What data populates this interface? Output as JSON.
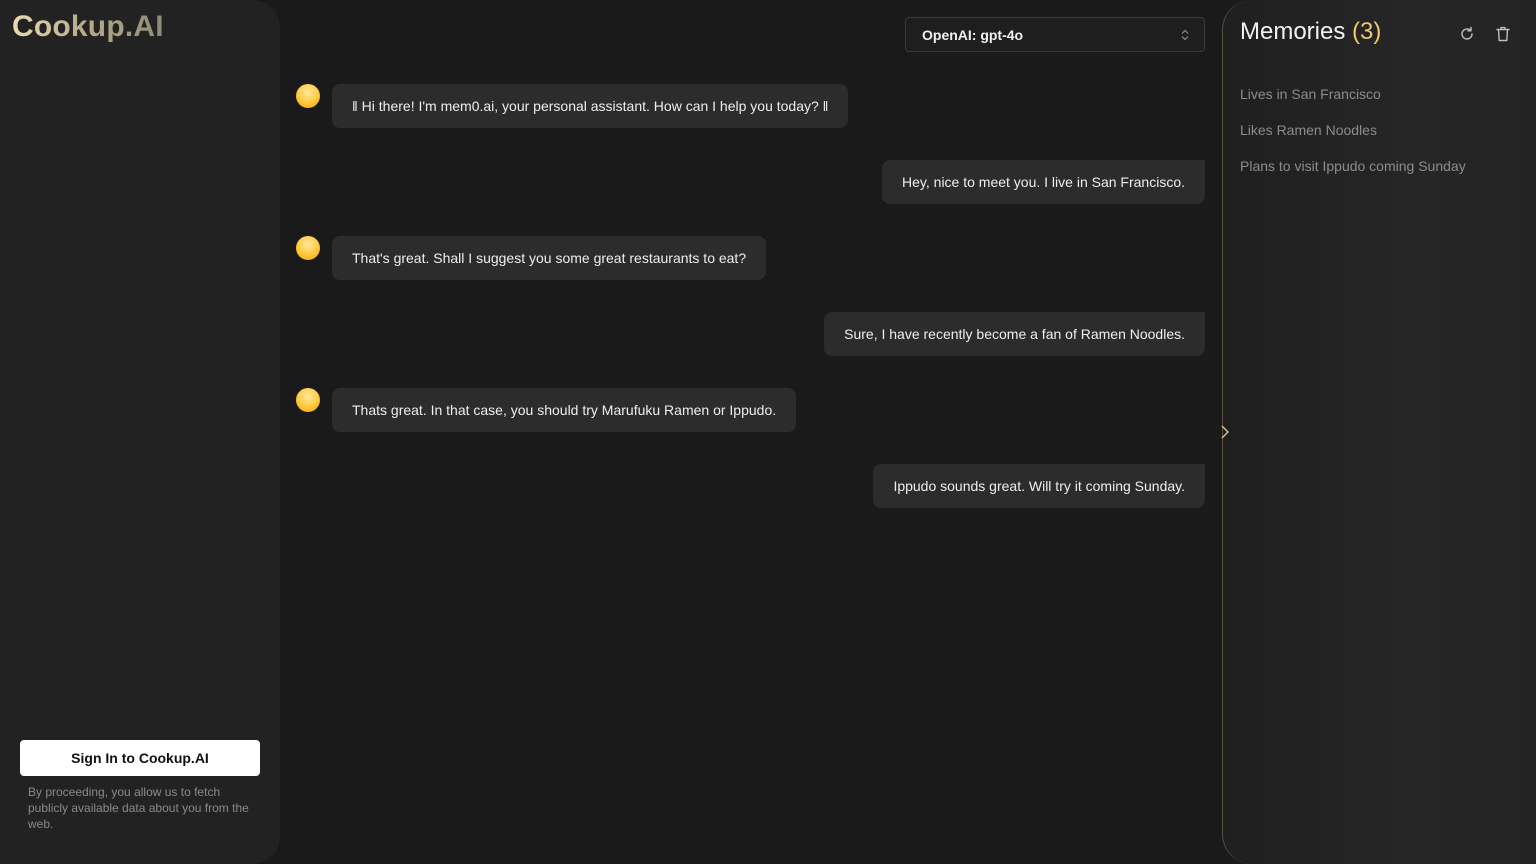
{
  "app": {
    "logo": "Cookup.AI"
  },
  "sidebar": {
    "signin_label": "Sign In to Cookup.AI",
    "disclaimer": "By proceeding, you allow us to fetch publicly available data about you from the web."
  },
  "model_select": {
    "value": "OpenAI: gpt-4o"
  },
  "chat": {
    "messages": [
      {
        "role": "assistant",
        "text": "‖ Hi there! I'm mem0.ai, your personal assistant. How can I help you today? ‖"
      },
      {
        "role": "user",
        "text": "Hey, nice to meet you. I live in San Francisco."
      },
      {
        "role": "assistant",
        "text": "That's great. Shall I suggest you some great restaurants to eat?"
      },
      {
        "role": "user",
        "text": "Sure, I have recently become a fan of Ramen Noodles."
      },
      {
        "role": "assistant",
        "text": "Thats great. In that case, you should try Marufuku Ramen or Ippudo."
      },
      {
        "role": "user",
        "text": "Ippudo sounds great. Will try it coming Sunday."
      }
    ]
  },
  "memories": {
    "title": "Memories",
    "count": "(3)",
    "items": [
      "Lives in San Francisco",
      "Likes Ramen Noodles",
      "Plans to visit Ippudo coming Sunday"
    ],
    "icons": [
      "refresh-icon",
      "trash-icon"
    ]
  },
  "colors": {
    "background": "#1a1a1a",
    "sidebar": "#222222",
    "bubble": "#2c2c2c",
    "accent": "#f1c96b",
    "avatar": "#ffc83a"
  }
}
